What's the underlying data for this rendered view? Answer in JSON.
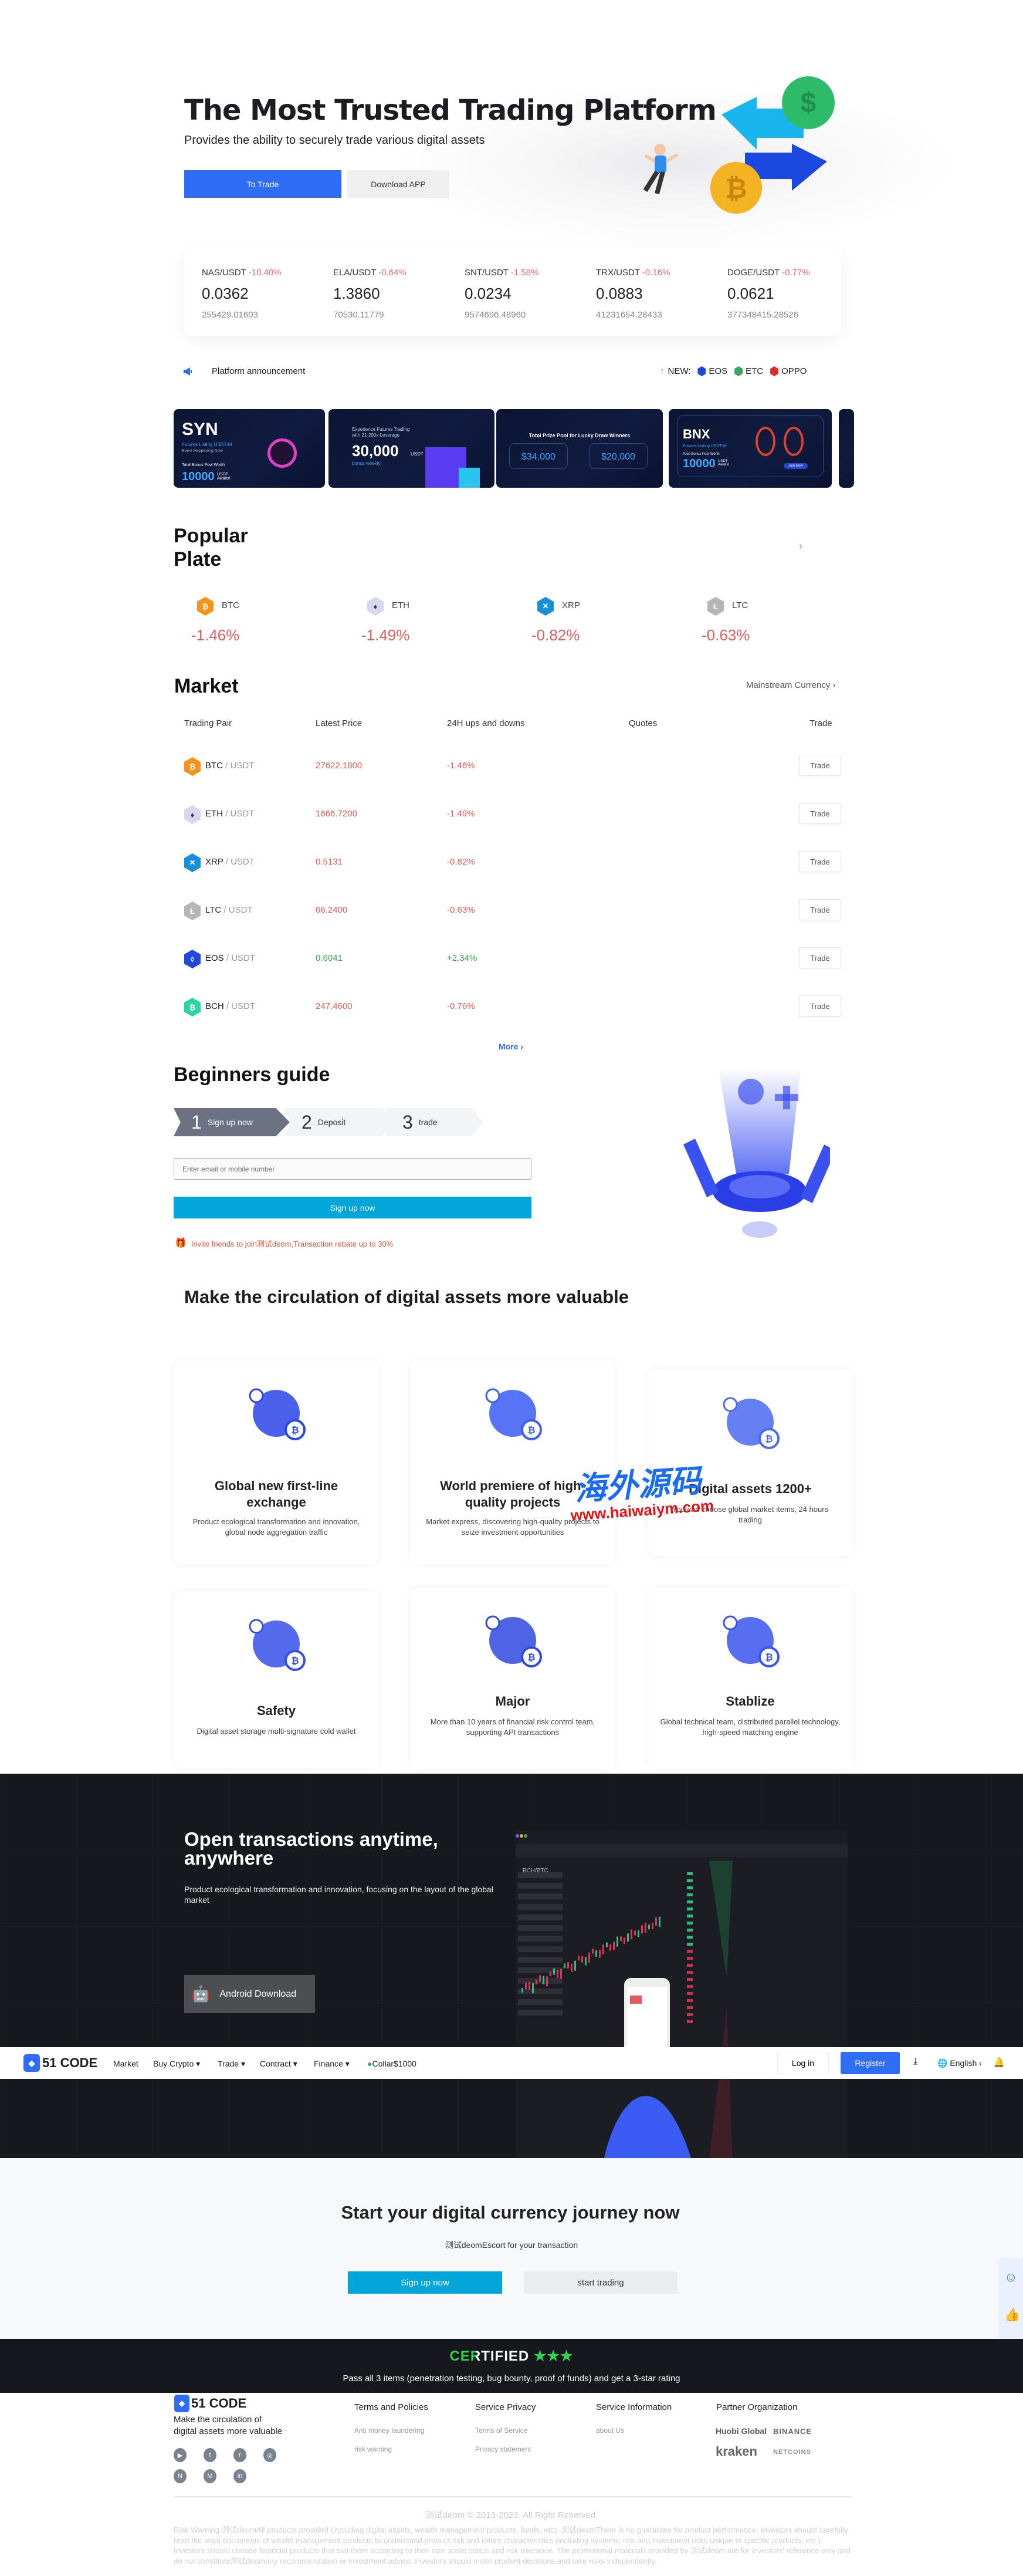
{
  "hero": {
    "title": "The Most Trusted Trading Platform",
    "subtitle": "Provides the ability to securely trade various digital assets",
    "to_trade": "To Trade",
    "download_app": "Download APP"
  },
  "ticker": [
    {
      "pair": "NAS/USDT",
      "change": "-10.40%",
      "price": "0.0362",
      "volume": "255429.01603"
    },
    {
      "pair": "ELA/USDT",
      "change": "-0.64%",
      "price": "1.3860",
      "volume": "70530.11779"
    },
    {
      "pair": "SNT/USDT",
      "change": "-1.58%",
      "price": "0.0234",
      "volume": "9574696.48960"
    },
    {
      "pair": "TRX/USDT",
      "change": "-0.16%",
      "price": "0.0883",
      "volume": "41231654.28433"
    },
    {
      "pair": "DOGE/USDT",
      "change": "-0.77%",
      "price": "0.0621",
      "volume": "377348415.28526"
    }
  ],
  "announcement": {
    "label": "Platform announcement",
    "new_label": "NEW:",
    "new_coins": [
      {
        "name": "EOS",
        "color": "#1f47d8"
      },
      {
        "name": "ETC",
        "color": "#3aa55c"
      },
      {
        "name": "OPPO",
        "color": "#d8312a"
      }
    ]
  },
  "banners": [
    {
      "title": "SYN",
      "line1": "Futures Listing USDT-M",
      "line2": "Event Happening Now",
      "line3": "Total Bonus Pool Worth",
      "amount": "10000",
      "unit": "USDT Awaits!"
    },
    {
      "line1": "Experience Futures Trading",
      "line2": "with 21-200x Leverage",
      "amount": "30,000",
      "unit": "USDT",
      "line3": "bonus weekly!"
    },
    {
      "title": "Total Prize Pool for Lucky Draw Winners",
      "amount": "$34,000",
      "amount2": "$20,000"
    },
    {
      "title": "BNX",
      "line1": "Futures Listing USDT-M",
      "line3": "Total Bonus Pool Worth",
      "amount": "10000",
      "unit": "USDT Awaits!",
      "cta": "Join Now"
    }
  ],
  "popular": {
    "title_line1": "Popular",
    "title_line2": "Plate",
    "items": [
      {
        "coin": "BTC",
        "change": "-1.46%",
        "color": "#f7931a",
        "glyph": "₿"
      },
      {
        "coin": "ETH",
        "change": "-1.49%",
        "color": "#d5d8ef",
        "glyph": "♦"
      },
      {
        "coin": "XRP",
        "change": "-0.82%",
        "color": "#1a8fd8",
        "glyph": "✕"
      },
      {
        "coin": "LTC",
        "change": "-0.63%",
        "color": "#b5b5b5",
        "glyph": "Ł"
      }
    ]
  },
  "market": {
    "title": "Market",
    "filter": "Mainstream Currency",
    "headers": [
      "Trading Pair",
      "Latest Price",
      "24H ups and downs",
      "Quotes",
      "Trade"
    ],
    "rows": [
      {
        "base": "BTC",
        "quote": "/ USDT",
        "price": "27622.1800",
        "change": "-1.46%",
        "up": false,
        "color": "#f7931a",
        "glyph": "₿"
      },
      {
        "base": "ETH",
        "quote": "/ USDT",
        "price": "1666.7200",
        "change": "-1.49%",
        "up": false,
        "color": "#d5d8ef",
        "glyph": "♦"
      },
      {
        "base": "XRP",
        "quote": "/ USDT",
        "price": "0.5131",
        "change": "-0.82%",
        "up": false,
        "color": "#1a8fd8",
        "glyph": "✕"
      },
      {
        "base": "LTC",
        "quote": "/ USDT",
        "price": "66.2400",
        "change": "-0.63%",
        "up": false,
        "color": "#b5b5b5",
        "glyph": "Ł"
      },
      {
        "base": "EOS",
        "quote": "/ USDT",
        "price": "0.6041",
        "change": "+2.34%",
        "up": true,
        "color": "#1f47d8",
        "glyph": "◊"
      },
      {
        "base": "BCH",
        "quote": "/ USDT",
        "price": "247.4600",
        "change": "-0.76%",
        "up": false,
        "color": "#2ed3a3",
        "glyph": "₿"
      }
    ],
    "trade_label": "Trade",
    "more": "More"
  },
  "guide": {
    "title": "Beginners guide",
    "steps": [
      {
        "num": "1",
        "label": "Sign up now"
      },
      {
        "num": "2",
        "label": "Deposit"
      },
      {
        "num": "3",
        "label": "trade"
      }
    ],
    "input_placeholder": "Enter email or mobile number",
    "signup": "Sign up now",
    "invite": "Invite friends to join测试deom,Transaction rebate up to 30%"
  },
  "features": {
    "title": "Make the circulation of digital assets more valuable",
    "cards": [
      {
        "title": "Global new first-line exchange",
        "desc": "Product ecological transformation and innovation, global node aggregation traffic"
      },
      {
        "title": "World premiere of high-quality projects",
        "desc": "Market express, discovering high-quality projects to seize investment opportunities"
      },
      {
        "title": "Digital assets 1200+",
        "desc": "You can choose global market items, 24 hours trading"
      },
      {
        "title": "Safety",
        "desc": "Digital asset storage multi-signature cold wallet"
      },
      {
        "title": "Major",
        "desc": "More than 10 years of financial risk control team, supporting API transactions"
      },
      {
        "title": "Stablize",
        "desc": "Global technical team, distributed parallel technology, high-speed matching engine"
      }
    ]
  },
  "watermark": {
    "cn": "海外源码",
    "url": "www.haiwaiym.com"
  },
  "app": {
    "title_line1": "Open transactions anytime,",
    "title_line2": "anywhere",
    "desc": "Product ecological transformation and innovation, focusing on the layout of the global market",
    "android": "Android Download",
    "mock_pair": "BCH/BTC"
  },
  "nav": {
    "logo": "51 CODE",
    "items": [
      "Market",
      "Buy Crypto ▾",
      "Trade ▾",
      "Contract ▾",
      "Finance ▾"
    ],
    "promo": "Collar$1000",
    "login": "Log in",
    "register": "Register",
    "language": "English"
  },
  "cta": {
    "title": "Start your digital currency journey now",
    "subtitle": "测试deomEscort for your transaction",
    "signup": "Sign up now",
    "start": "start trading"
  },
  "certified": {
    "logo": "CERTIFIED",
    "text": "Pass all 3 items (penetration testing, bug bounty, proof of funds) and get a 3-star rating"
  },
  "footer": {
    "logo": "51 CODE",
    "tagline_line1": "Make the circulation of",
    "tagline_line2": "digital assets more valuable",
    "social": [
      "youtube",
      "twitter",
      "reddit",
      "instagram",
      "N",
      "M",
      "in"
    ],
    "columns": [
      {
        "title": "Terms and Policies",
        "links": [
          "Anti money laundering",
          "risk warning"
        ]
      },
      {
        "title": "Service Privacy",
        "links": [
          "Terms of Service",
          "Privacy statement"
        ]
      },
      {
        "title": "Service Information",
        "links": [
          "about Us"
        ]
      }
    ],
    "partners_title": "Partner Organization",
    "partners": [
      "Huobi Global",
      "BINANCE",
      "kraken",
      "NETCOINS"
    ],
    "copyright": "测试deom © 2013-2023. All Right Reserved.",
    "risk": "Risk Warning:测试deomAll products provided (including digital assets, wealth management products, funds, etc), 测试deomThere is no guarantee for product performance. Investors should carefully read the legal documents of wealth management products to understand product risk and return characteristics (including systemic risk and investment risks unique to specific products, etc.). Investors should choose financial products that suit them according to their own asset status and risk tolerance. The promotional materials provided by 测试deom are for investors' reference only and do not constitute测试deomany recommendation or investment advice. Investors should make prudent decisions and take risks independently."
  },
  "colors": {
    "accent": "#2f6df6",
    "cyan": "#00a6d9",
    "down": "#e65a5a",
    "up": "#3aa55c",
    "dark": "#16181d"
  }
}
